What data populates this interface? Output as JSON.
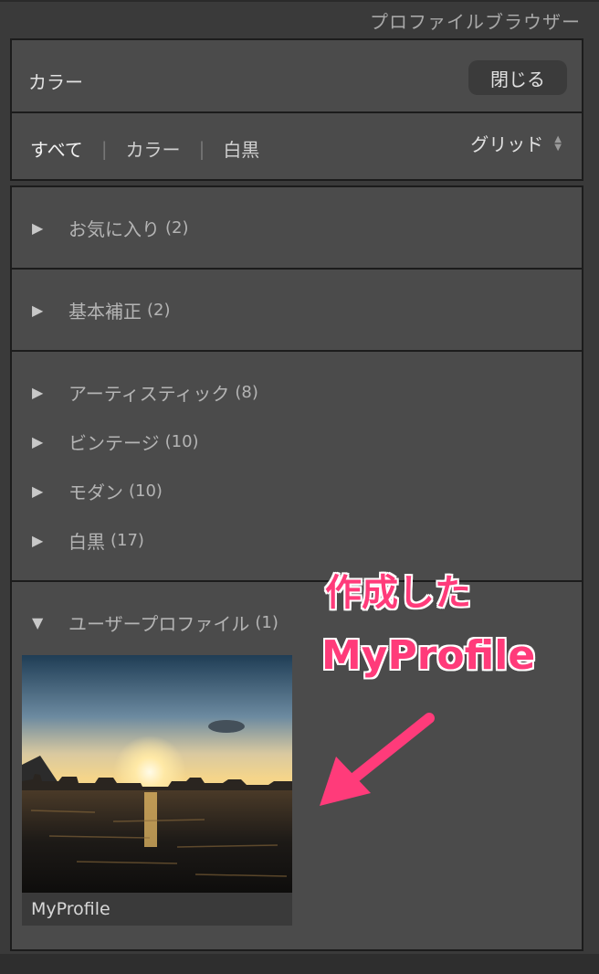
{
  "panel": {
    "title": "プロファイルブラウザー"
  },
  "header": {
    "current": "カラー",
    "close_label": "閉じる"
  },
  "filter": {
    "tabs": [
      {
        "label": "すべて",
        "active": true
      },
      {
        "label": "カラー",
        "active": false
      },
      {
        "label": "白黒",
        "active": false
      }
    ],
    "view_mode": "グリッド"
  },
  "groups": [
    {
      "name": "お気に入り",
      "count": "(2)",
      "expanded": false
    },
    {
      "name": "基本補正",
      "count": "(2)",
      "expanded": false
    },
    {
      "name": "アーティスティック",
      "count": "(8)",
      "expanded": false
    },
    {
      "name": "ビンテージ",
      "count": "(10)",
      "expanded": false
    },
    {
      "name": "モダン",
      "count": "(10)",
      "expanded": false
    },
    {
      "name": "白黒",
      "count": "(17)",
      "expanded": false
    },
    {
      "name": "ユーザープロファイル",
      "count": "(1)",
      "expanded": true
    }
  ],
  "user_profiles": [
    {
      "label": "MyProfile"
    }
  ],
  "annotation": {
    "line1": "作成した",
    "line2": "MyProfile",
    "color": "#ff3b7a"
  },
  "icons": {
    "collapsed": "triangle-right-icon",
    "expanded": "triangle-down-icon",
    "sort": "updown-arrows-icon"
  }
}
